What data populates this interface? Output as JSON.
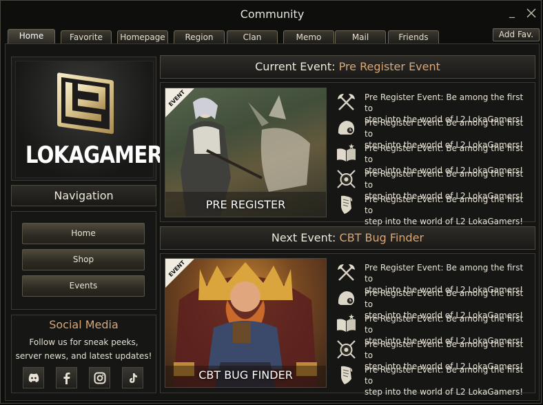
{
  "window": {
    "title": "Community",
    "minimize_label": "_",
    "close_label": "╳"
  },
  "tabs": [
    {
      "label": "Home",
      "active": true
    },
    {
      "label": "Favorite"
    },
    {
      "label": "Homepage"
    },
    {
      "label": "Region"
    },
    {
      "label": "Clan"
    },
    {
      "label": "Memo"
    },
    {
      "label": "Mail"
    },
    {
      "label": "Friends"
    }
  ],
  "add_fav_label": "Add Fav.",
  "logo": {
    "text": "LOKAGAMERS"
  },
  "navigation": {
    "title": "Navigation",
    "items": [
      {
        "label": "Home"
      },
      {
        "label": "Shop"
      },
      {
        "label": "Events"
      }
    ]
  },
  "social": {
    "title": "Social Media",
    "text_line1": "Follow us for sneak peeks,",
    "text_line2": "server news, and latest updates!",
    "icons": [
      "discord-icon",
      "facebook-icon",
      "instagram-icon",
      "tiktok-icon"
    ]
  },
  "current_event": {
    "prefix": "Current Event:",
    "name": "Pre Register Event",
    "banner_tag": "EVENT",
    "banner_label": "PRE REGISTER",
    "items": [
      {
        "icon": "crossed-axes-icon",
        "line1": "Pre Register Event: Be among the first to",
        "line2": "step into the world of L2 LokaGamers!"
      },
      {
        "icon": "helmet-icon",
        "line1": "Pre Register Event: Be among the first to",
        "line2": "step into the world of L2 LokaGamers!"
      },
      {
        "icon": "open-book-icon",
        "line1": "Pre Register Event: Be among the first to",
        "line2": "step into the world of L2 LokaGamers!"
      },
      {
        "icon": "crossed-swords-shield-icon",
        "line1": "Pre Register Event: Be among the first to",
        "line2": "step into the world of L2 LokaGamers!"
      },
      {
        "icon": "scroll-icon",
        "line1": "Pre Register Event: Be among the first to",
        "line2": "step into the world of L2 LokaGamers!"
      }
    ]
  },
  "next_event": {
    "prefix": "Next Event:",
    "name": "CBT Bug Finder",
    "banner_tag": "EVENT",
    "banner_label": "CBT BUG FINDER",
    "items": [
      {
        "icon": "crossed-axes-icon",
        "line1": "Pre Register Event: Be among the first to",
        "line2": "step into the world of L2 LokaGamers!"
      },
      {
        "icon": "helmet-icon",
        "line1": "Pre Register Event: Be among the first to",
        "line2": "step into the world of L2 LokaGamers!"
      },
      {
        "icon": "open-book-icon",
        "line1": "Pre Register Event: Be among the first to",
        "line2": "step into the world of L2 LokaGamers!"
      },
      {
        "icon": "crossed-swords-shield-icon",
        "line1": "Pre Register Event: Be among the first to",
        "line2": "step into the world of L2 LokaGamers!"
      },
      {
        "icon": "scroll-icon",
        "line1": "Pre Register Event: Be among the first to",
        "line2": "step into the world of L2 LokaGamers!"
      }
    ]
  },
  "colors": {
    "accent": "#d9a877",
    "background": "#141413",
    "border": "#3d3b35"
  }
}
